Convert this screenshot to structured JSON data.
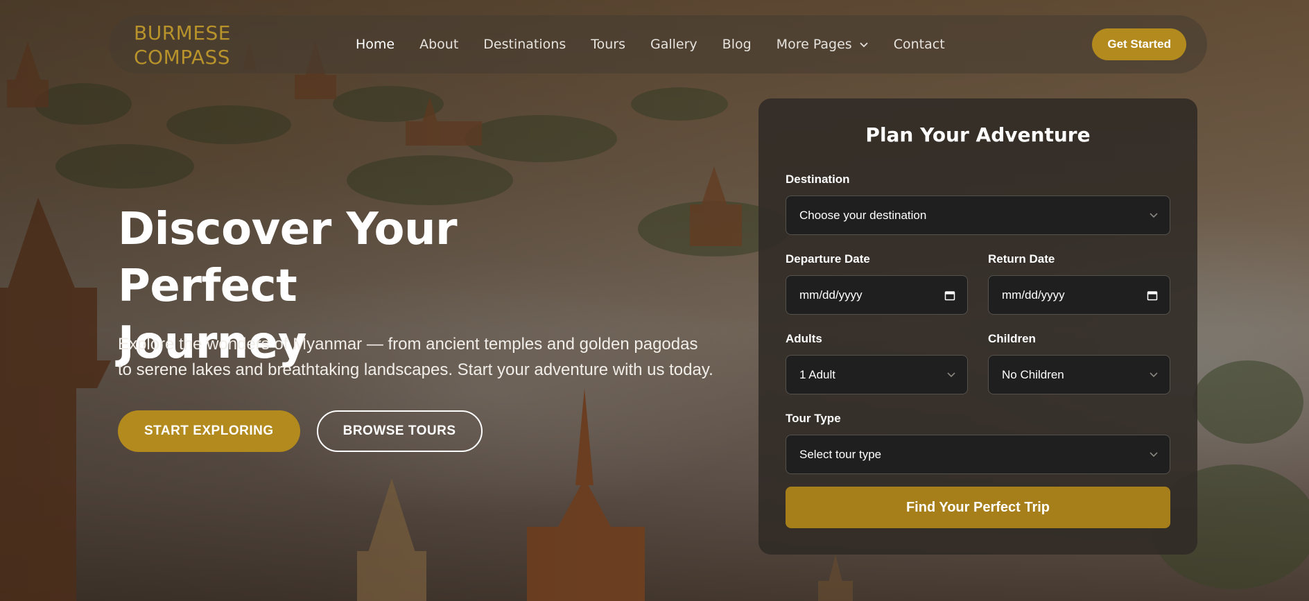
{
  "brand": {
    "line1": "BURMESE",
    "line2": "COMPASS"
  },
  "nav": {
    "items": [
      {
        "label": "Home",
        "active": true
      },
      {
        "label": "About"
      },
      {
        "label": "Destinations"
      },
      {
        "label": "Tours"
      },
      {
        "label": "Gallery"
      },
      {
        "label": "Blog"
      },
      {
        "label": "More Pages",
        "has_dropdown": true
      },
      {
        "label": "Contact"
      }
    ],
    "cta_label": "Get Started"
  },
  "hero": {
    "title_line1": "Discover Your Perfect",
    "title_line2": "Journey",
    "description": "Explore the wonders of Myanmar — from ancient temples and golden pagodas to serene lakes and breathtaking landscapes. Start your adventure with us today.",
    "primary_button": "START EXPLORING",
    "secondary_button": "BROWSE TOURS"
  },
  "booking": {
    "title": "Plan Your Adventure",
    "destination": {
      "label": "Destination",
      "value": "Choose your destination"
    },
    "departure": {
      "label": "Departure Date",
      "value": "mm/dd/yyyy"
    },
    "return": {
      "label": "Return Date",
      "value": "mm/dd/yyyy"
    },
    "adults": {
      "label": "Adults",
      "value": "1 Adult"
    },
    "children": {
      "label": "Children",
      "value": "No Children"
    },
    "tour_type": {
      "label": "Tour Type",
      "value": "Select tour type"
    },
    "submit": "Find Your Perfect Trip"
  },
  "colors": {
    "accent": "#b38a1e",
    "card_bg": "#302a26",
    "input_bg": "#1f1f1f"
  },
  "icons": {
    "dropdown": "chevron-down-icon",
    "date": "calendar-icon"
  }
}
